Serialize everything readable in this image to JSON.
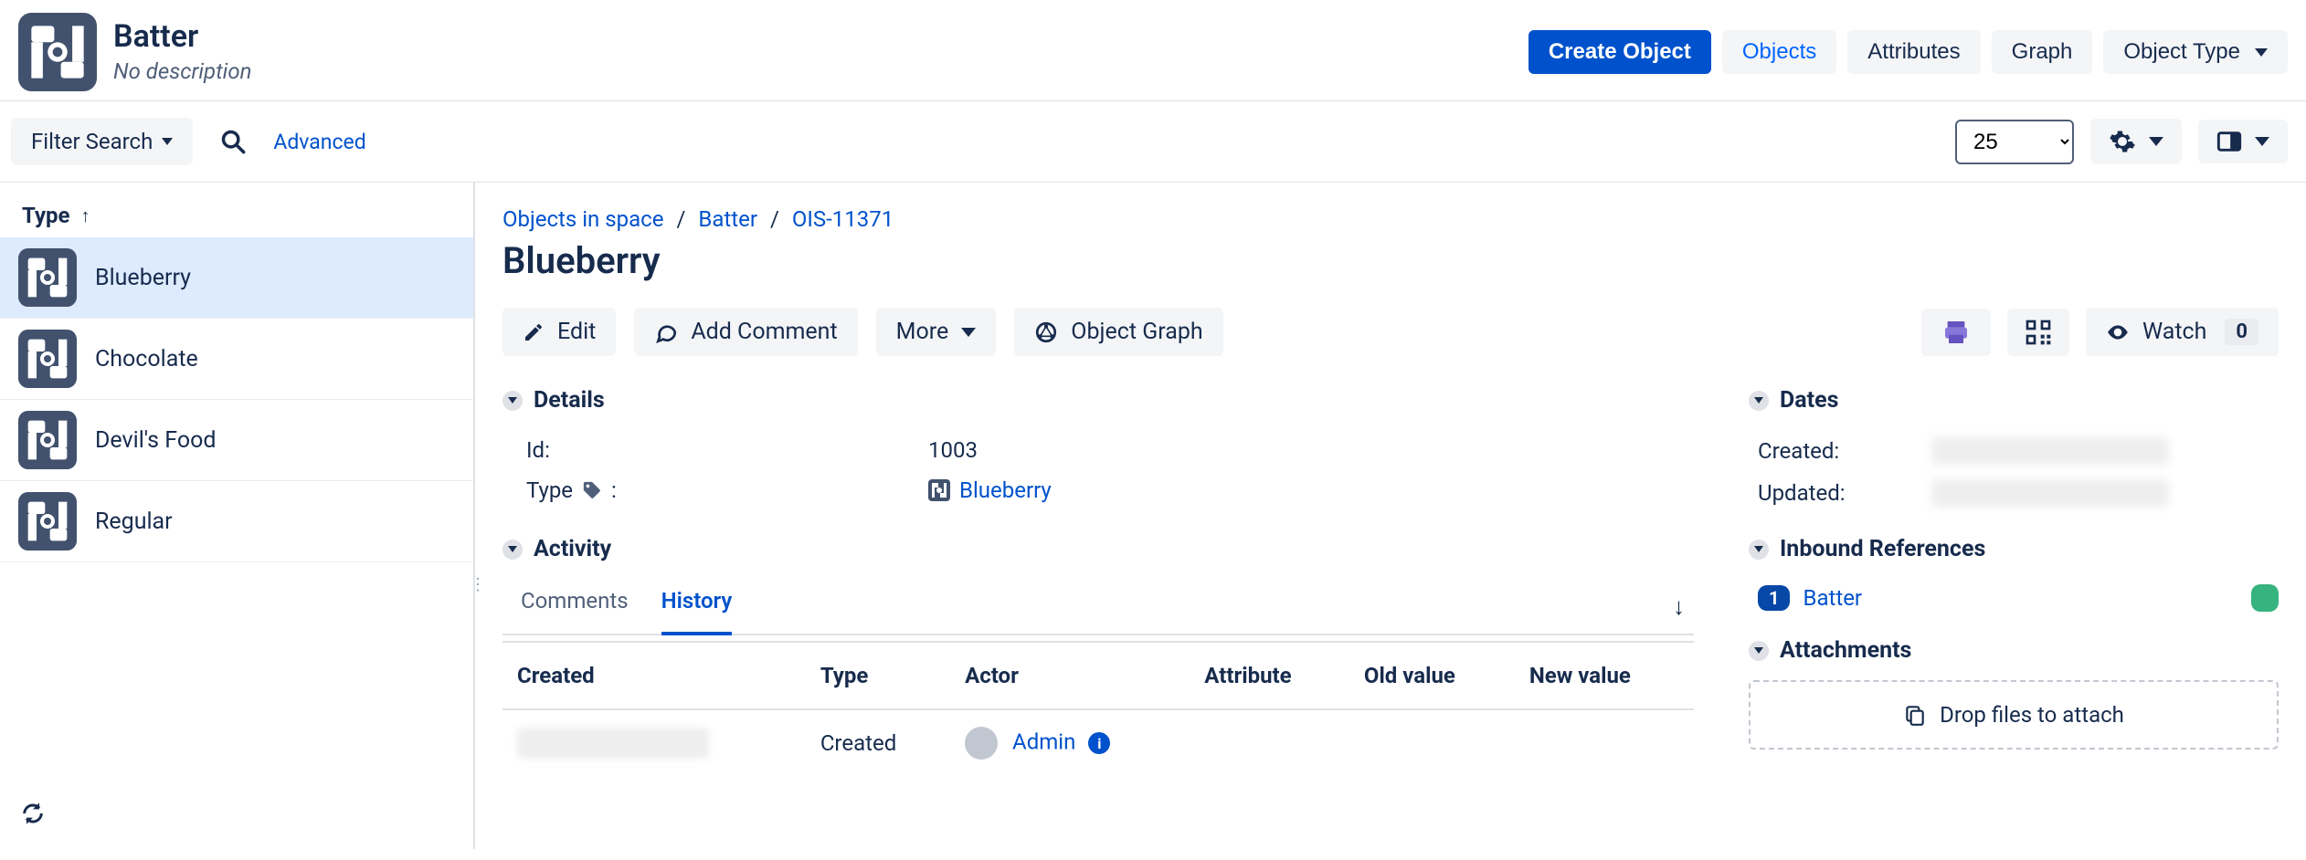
{
  "header": {
    "title": "Batter",
    "subtitle": "No description",
    "create_button": "Create Object",
    "nav": {
      "objects": "Objects",
      "attributes": "Attributes",
      "graph": "Graph",
      "object_type": "Object Type"
    }
  },
  "toolbar": {
    "filter_label": "Filter Search",
    "advanced_label": "Advanced",
    "page_size": "25"
  },
  "sidebar": {
    "sort_label": "Type",
    "items": [
      {
        "label": "Blueberry",
        "selected": true
      },
      {
        "label": "Chocolate",
        "selected": false
      },
      {
        "label": "Devil's Food",
        "selected": false
      },
      {
        "label": "Regular",
        "selected": false
      }
    ]
  },
  "breadcrumb": {
    "root": "Objects in space",
    "schema": "Batter",
    "key": "OIS-11371"
  },
  "object": {
    "title": "Blueberry",
    "actions": {
      "edit": "Edit",
      "add_comment": "Add Comment",
      "more": "More",
      "object_graph": "Object Graph",
      "watch": "Watch",
      "watch_count": "0"
    },
    "details": {
      "section_label": "Details",
      "rows": {
        "id_label": "Id:",
        "id_value": "1003",
        "type_label": "Type",
        "type_value": "Blueberry"
      }
    },
    "activity": {
      "section_label": "Activity",
      "tabs": {
        "comments": "Comments",
        "history": "History"
      },
      "columns": {
        "created": "Created",
        "type": "Type",
        "actor": "Actor",
        "attribute": "Attribute",
        "old_value": "Old value",
        "new_value": "New value"
      },
      "rows": [
        {
          "type": "Created",
          "actor": "Admin"
        }
      ]
    }
  },
  "right": {
    "dates": {
      "section_label": "Dates",
      "created_label": "Created:",
      "updated_label": "Updated:"
    },
    "inbound": {
      "section_label": "Inbound References",
      "count": "1",
      "link": "Batter"
    },
    "attachments": {
      "section_label": "Attachments",
      "dropzone": "Drop files to attach"
    }
  }
}
